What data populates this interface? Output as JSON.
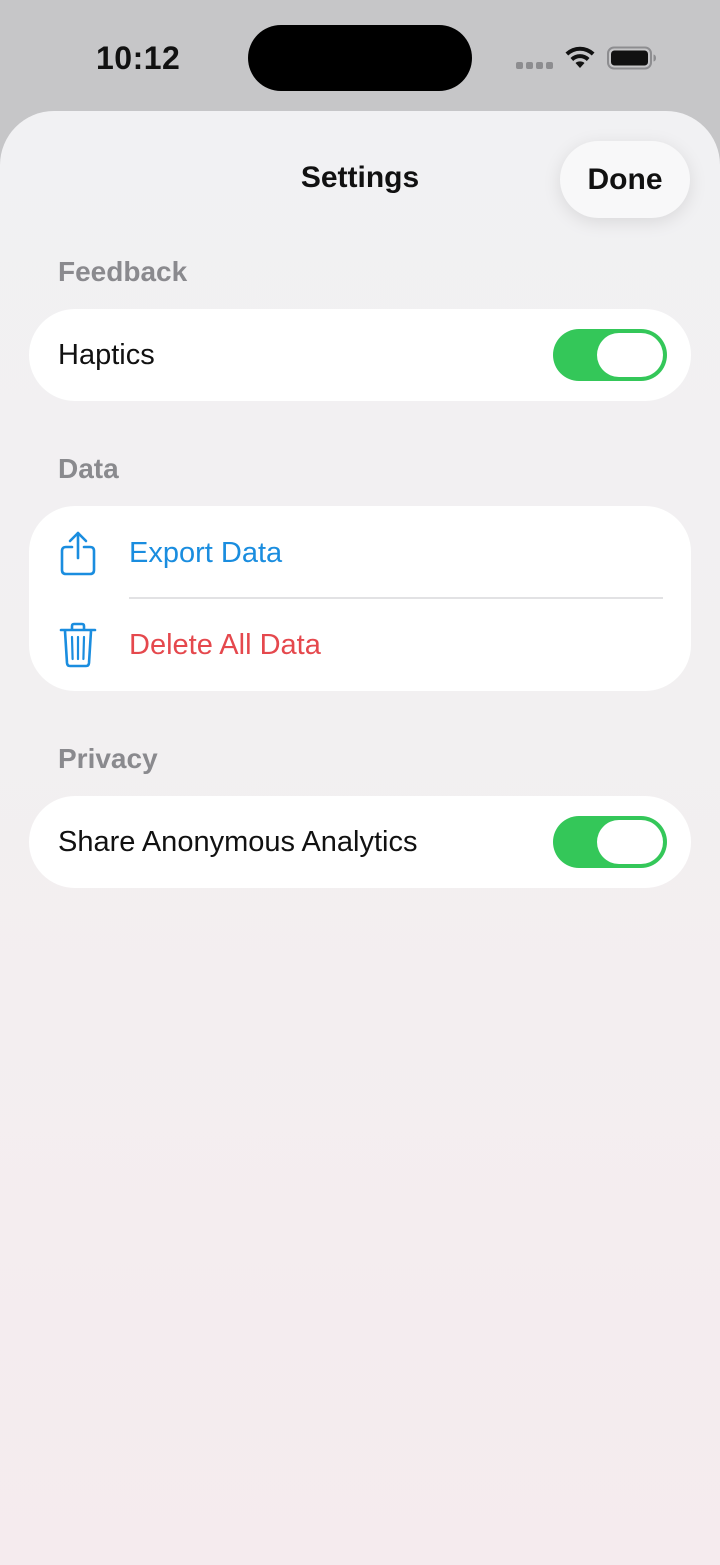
{
  "status_bar": {
    "time": "10:12"
  },
  "sheet": {
    "title": "Settings",
    "done_label": "Done"
  },
  "sections": {
    "feedback": {
      "header": "Feedback",
      "haptics_label": "Haptics",
      "haptics_on": true
    },
    "data": {
      "header": "Data",
      "export_label": "Export Data",
      "export_icon": "share-icon",
      "delete_label": "Delete All Data",
      "delete_icon": "trash-icon"
    },
    "privacy": {
      "header": "Privacy",
      "analytics_label": "Share Anonymous Analytics",
      "analytics_on": true
    }
  },
  "colors": {
    "accent_blue": "#1a8ddf",
    "destructive_red": "#e5484d",
    "toggle_on": "#34c759"
  }
}
